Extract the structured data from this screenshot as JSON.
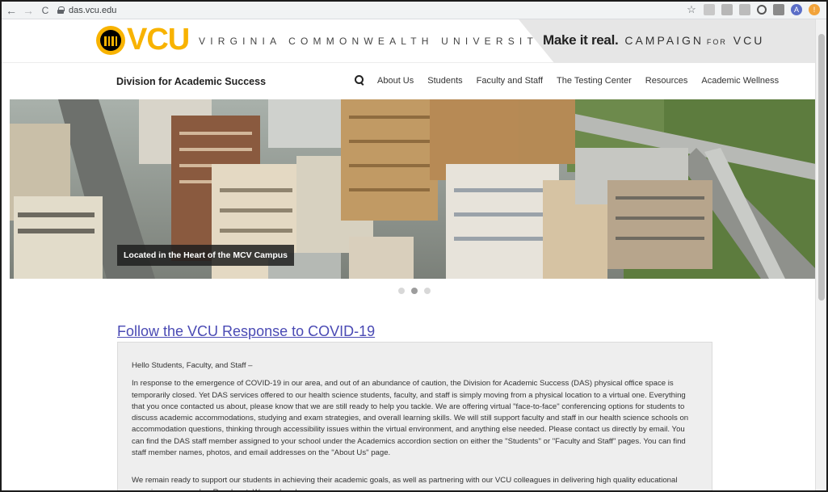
{
  "browser": {
    "back": "←",
    "forward": "→",
    "reload": "C",
    "url": "das.vcu.edu",
    "avatar_letter": "A",
    "icons": [
      "star-icon",
      "extension-icon",
      "pdf-icon",
      "g-icon",
      "qr-icon",
      "profile-avatar",
      "alert-icon"
    ]
  },
  "brand": {
    "logo_text": "VCU",
    "university": "VIRGINIA COMMONWEALTH UNIVERSITY",
    "campaign_bold": "Make it real.",
    "campaign_spaced": "CAMPAIGN",
    "campaign_for": "FOR",
    "campaign_vcu": "VCU",
    "gold": "#f8b300"
  },
  "nav": {
    "title": "Division for Academic Success",
    "links": [
      "About Us",
      "Students",
      "Faculty and Staff",
      "The Testing Center",
      "Resources",
      "Academic Wellness"
    ]
  },
  "hero": {
    "caption": "Located in the Heart of the MCV Campus",
    "slide_count": 3,
    "active_slide": 2
  },
  "covid": {
    "link": "Follow the VCU Response to COVID-19",
    "greeting": "Hello Students, Faculty, and Staff –",
    "paragraph1": "In response to the emergence of COVID-19 in our area, and out of an abundance of caution, the Division for Academic Success (DAS) physical office space is temporarily closed. Yet DAS services offered to our health science students, faculty, and staff is simply moving from a physical location to a virtual one. Everything that you once contacted us about, please know that we are still ready to help you tackle. We are offering virtual \"face-to-face\" conferencing options for students to discuss academic accommodations, studying and exam strategies, and overall learning skills. We will still support faculty and staff in our health science schools on accommodation questions, thinking through accessibility issues within the virtual environment, and anything else needed. Please contact us directly by email. You can find the DAS staff member assigned to your school under the Academics accordion section on either the \"Students\" or \"Faculty and Staff\" pages. You can find staff member names, photos, and email addresses on the \"About Us\" page.",
    "paragraph2": "We remain ready to support our students in achieving their academic goals, as well as partnering with our VCU colleagues in delivering high quality educational experiences every day. Reach out. We are here!"
  }
}
